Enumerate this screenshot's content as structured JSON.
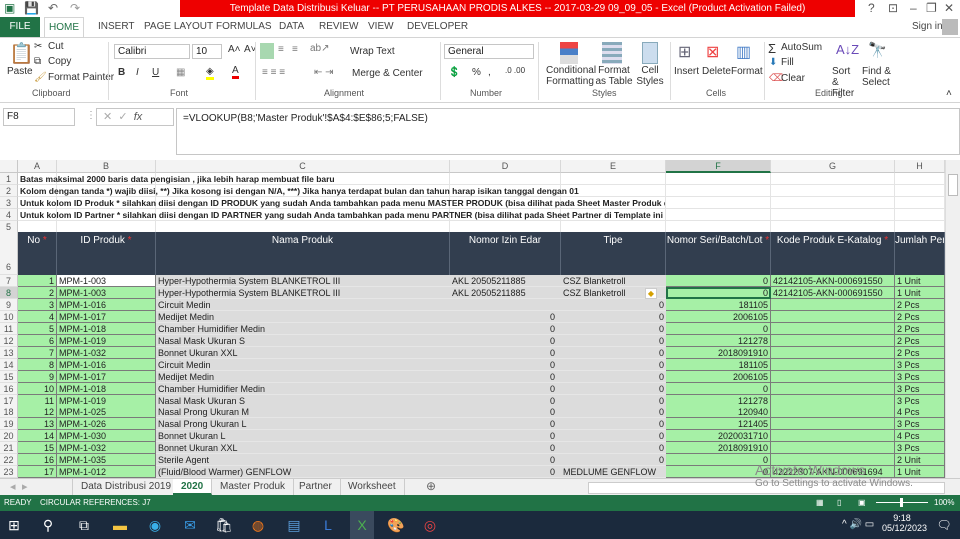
{
  "title": "Template Data Distribusi Keluar -- PT PERUSAHAAN PRODIS ALKES -- 2017-03-29 09_09_05 -  Excel (Product Activation Failed)",
  "ribbon_tabs": [
    "FILE",
    "HOME",
    "INSERT",
    "PAGE LAYOUT",
    "FORMULAS",
    "DATA",
    "REVIEW",
    "VIEW",
    "DEVELOPER"
  ],
  "sign_in": "Sign in",
  "clipboard": {
    "paste": "Paste",
    "cut": "Cut",
    "copy": "Copy",
    "format_painter": "Format Painter",
    "group": "Clipboard"
  },
  "font": {
    "name": "Calibri",
    "size": "10",
    "group": "Font",
    "bold": "B",
    "italic": "I",
    "underline": "U"
  },
  "alignment": {
    "wrap": "Wrap Text",
    "merge": "Merge & Center",
    "group": "Alignment"
  },
  "number": {
    "format": "General",
    "percent": "%",
    "comma": ",",
    "group": "Number"
  },
  "styles": {
    "conditional": "Conditional Formatting",
    "format_table": "Format as Table",
    "cell_styles": "Cell Styles",
    "group": "Styles"
  },
  "cells": {
    "insert": "Insert",
    "delete": "Delete",
    "format": "Format",
    "group": "Cells"
  },
  "editing": {
    "autosum": "AutoSum",
    "fill": "Fill",
    "clear": "Clear",
    "sort": "Sort & Filter",
    "find": "Find & Select",
    "group": "Editing"
  },
  "formula_bar": {
    "name_box": "F8",
    "formula": "=VLOOKUP(B8;'Master Produk'!$A$4:$E$86;5;FALSE)"
  },
  "columns": [
    "A",
    "B",
    "C",
    "D",
    "E",
    "F",
    "G",
    "H"
  ],
  "notes": [
    "Batas maksimal 2000 baris data pengisian , jika lebih harap membuat file baru",
    "Kolom dengan tanda *) wajib diisi, **) Jika kosong isi dengan N/A, ***)  Jika hanya terdapat bulan dan tahun harap isikan tanggal dengan 01",
    "Untuk kolom ID Produk * silahkan diisi dengan ID PRODUK yang sudah Anda tambahkan pada menu MASTER PRODUK (bisa dilihat pada Sheet Master Produk di Template ini",
    "Untuk kolom ID Partner * silahkan diisi dengan ID PARTNER yang sudah Anda tambahkan pada menu PARTNER (bisa dilihat pada Sheet Partner di Template ini"
  ],
  "headers": [
    "No",
    "ID Produk",
    "Nama Produk",
    "Nomor Izin Edar",
    "Tipe",
    "Nomor Seri/Batch/Lot",
    "Kode Produk E-Katalog",
    "Jumlah Per"
  ],
  "rows": [
    [
      "1",
      "MPM-1-003",
      "Hyper-Hypothermia System BLANKETROL III",
      "AKL 20505211885",
      "CSZ Blanketroll",
      "0",
      "42142105-AKN-000691550",
      "1 Unit"
    ],
    [
      "2",
      "MPM-1-003",
      "Hyper-Hypothermia System BLANKETROL III",
      "AKL 20505211885",
      "CSZ Blanketroll",
      "0",
      "42142105-AKN-000691550",
      "1 Unit"
    ],
    [
      "3",
      "MPM-1-016",
      "Circuit Medin",
      "",
      "0",
      "181105",
      "",
      "2 Pcs"
    ],
    [
      "4",
      "MPM-1-017",
      "Medijet Medin",
      "0",
      "0",
      "2006105",
      "",
      "2 Pcs"
    ],
    [
      "5",
      "MPM-1-018",
      "Chamber Humidifier Medin",
      "0",
      "0",
      "0",
      "",
      "2 Pcs"
    ],
    [
      "6",
      "MPM-1-019",
      "Nasal Mask Ukuran S",
      "0",
      "0",
      "121278",
      "",
      "2 Pcs"
    ],
    [
      "7",
      "MPM-1-032",
      "Bonnet Ukuran XXL",
      "0",
      "0",
      "2018091910",
      "",
      "2 Pcs"
    ],
    [
      "8",
      "MPM-1-016",
      "Circuit Medin",
      "0",
      "0",
      "181105",
      "",
      "3 Pcs"
    ],
    [
      "9",
      "MPM-1-017",
      "Medijet Medin",
      "0",
      "0",
      "2006105",
      "",
      "3 Pcs"
    ],
    [
      "10",
      "MPM-1-018",
      "Chamber Humidifier Medin",
      "0",
      "0",
      "0",
      "",
      "3 Pcs"
    ],
    [
      "11",
      "MPM-1-019",
      "Nasal Mask Ukuran S",
      "0",
      "0",
      "121278",
      "",
      "3 Pcs"
    ],
    [
      "12",
      "MPM-1-025",
      "Nasal Prong Ukuran M",
      "0",
      "0",
      "120940",
      "",
      "4 Pcs"
    ],
    [
      "13",
      "MPM-1-026",
      "Nasal Prong Ukuran L",
      "0",
      "0",
      "121405",
      "",
      "3 Pcs"
    ],
    [
      "14",
      "MPM-1-030",
      "Bonnet Ukuran L",
      "0",
      "0",
      "2020031710",
      "",
      "4 Pcs"
    ],
    [
      "15",
      "MPM-1-032",
      "Bonnet Ukuran XXL",
      "0",
      "0",
      "2018091910",
      "",
      "3 Pcs"
    ],
    [
      "16",
      "MPM-1-035",
      "Sterile Agent",
      "0",
      "0",
      "0",
      "",
      "2 Unit"
    ],
    [
      "17",
      "MPM-1-012",
      "(Fluid/Blood Warmer) GENFLOW",
      "0",
      "MEDLUME GENFLOW",
      "0",
      "42222307-AKN-000691694",
      "1 Unit"
    ]
  ],
  "sheet_tabs": [
    "Data Distribusi 2019",
    "2020",
    "Master Produk",
    "Partner",
    "Worksheet"
  ],
  "active_sheet": "2020",
  "status": {
    "ready": "READY",
    "circular": "CIRCULAR REFERENCES: J7",
    "zoom": "100%"
  },
  "watermark": {
    "line1": "Activate Windows",
    "line2": "Go to Settings to activate Windows."
  },
  "clock": {
    "time": "9:18",
    "date": "05/12/2023"
  },
  "colors": {
    "excel_green": "#217346",
    "title_red": "#e00000",
    "cell_green": "#a6f0a6",
    "header_dark": "#323e4f"
  }
}
